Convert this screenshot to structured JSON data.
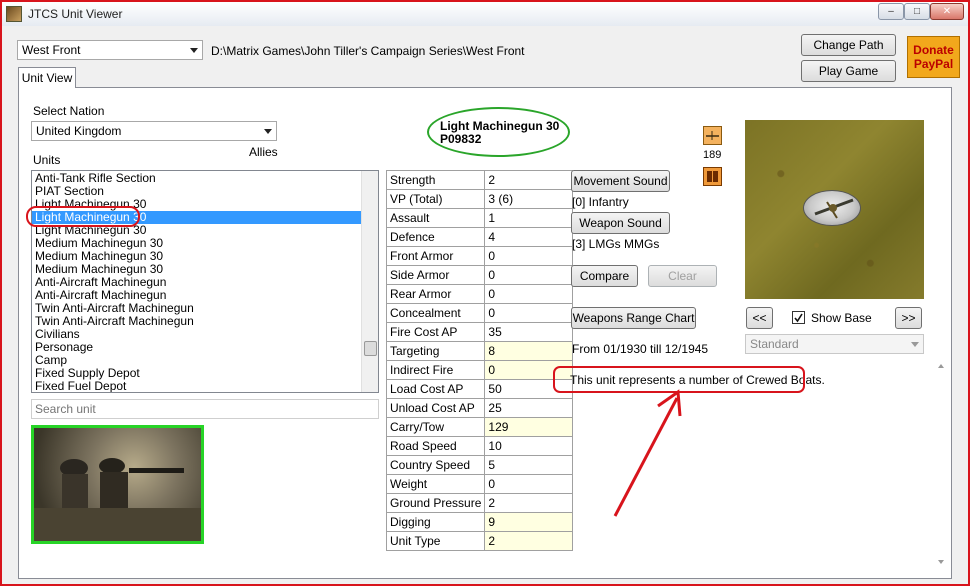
{
  "window": {
    "title": "JTCS Unit Viewer"
  },
  "window_buttons": [
    "–",
    "□",
    "✕"
  ],
  "game_select": {
    "value": "West Front"
  },
  "path": "D:\\Matrix Games\\John Tiller's Campaign Series\\West Front",
  "buttons": {
    "change_path": "Change Path",
    "play_game": "Play Game",
    "donate_line1": "Donate",
    "donate_line2": "PayPal",
    "movement_sound": "Movement Sound",
    "weapon_sound": "Weapon Sound",
    "compare": "Compare",
    "clear": "Clear",
    "weapons_range_chart": "Weapons Range Chart",
    "prev": "<<",
    "next": ">>"
  },
  "tab": {
    "label": "Unit View"
  },
  "nation": {
    "label": "Select Nation",
    "value": "United Kingdom",
    "side": "Allies"
  },
  "units": {
    "label": "Units",
    "items": [
      "Anti-Tank Rifle Section",
      "PIAT Section",
      "Light Machinegun 30",
      "Light Machinegun 30",
      "Light Machinegun 30",
      "Medium Machinegun 30",
      "Medium Machinegun 30",
      "Medium Machinegun 30",
      "Anti-Aircraft Machinegun",
      "Anti-Aircraft Machinegun",
      "Twin Anti-Aircraft Machinegun",
      "Twin Anti-Aircraft Machinegun",
      "Civilians",
      "Personage",
      "Camp",
      "Fixed Supply Depot",
      "Fixed Fuel Depot"
    ],
    "selected_index": 3
  },
  "search": {
    "placeholder": "Search unit"
  },
  "unit_header": {
    "name": "Light Machinegun 30",
    "code": "P09832"
  },
  "stats": [
    {
      "key": "Strength",
      "value": "2",
      "hl": false
    },
    {
      "key": "VP (Total)",
      "value": "3 (6)",
      "hl": false
    },
    {
      "key": "Assault",
      "value": "1",
      "hl": false
    },
    {
      "key": "Defence",
      "value": "4",
      "hl": false
    },
    {
      "key": "Front Armor",
      "value": "0",
      "hl": false
    },
    {
      "key": "Side Armor",
      "value": "0",
      "hl": false
    },
    {
      "key": "Rear Armor",
      "value": "0",
      "hl": false
    },
    {
      "key": "Concealment",
      "value": "0",
      "hl": false
    },
    {
      "key": "Fire Cost AP",
      "value": "35",
      "hl": false
    },
    {
      "key": "Targeting",
      "value": "8",
      "hl": true
    },
    {
      "key": "Indirect Fire",
      "value": "0",
      "hl": true
    },
    {
      "key": "Load Cost AP",
      "value": "50",
      "hl": false
    },
    {
      "key": "Unload Cost AP",
      "value": "25",
      "hl": false
    },
    {
      "key": "Carry/Tow",
      "value": "129",
      "hl": true
    },
    {
      "key": "Road Speed",
      "value": "10",
      "hl": false
    },
    {
      "key": "Country Speed",
      "value": "5",
      "hl": false
    },
    {
      "key": "Weight",
      "value": "0",
      "hl": false
    },
    {
      "key": "Ground Pressure",
      "value": "2",
      "hl": false
    },
    {
      "key": "Digging",
      "value": "9",
      "hl": true
    },
    {
      "key": "Unit Type",
      "value": "2",
      "hl": true
    }
  ],
  "movement_info": "[0] Infantry",
  "weapon_info": "[3] LMGs MMGs",
  "date_range": "From 01/1930 till 12/1945",
  "description": "This unit represents a number of Crewed Boats.",
  "icon_counter": "189",
  "show_base": {
    "label": "Show Base",
    "checked": true
  },
  "style_select": {
    "value": "Standard"
  },
  "colors": {
    "highlight_cell": "#ffffe1",
    "selection": "#3399ff",
    "annotation_red": "#d8141c",
    "annotation_green": "#2aa52a"
  }
}
